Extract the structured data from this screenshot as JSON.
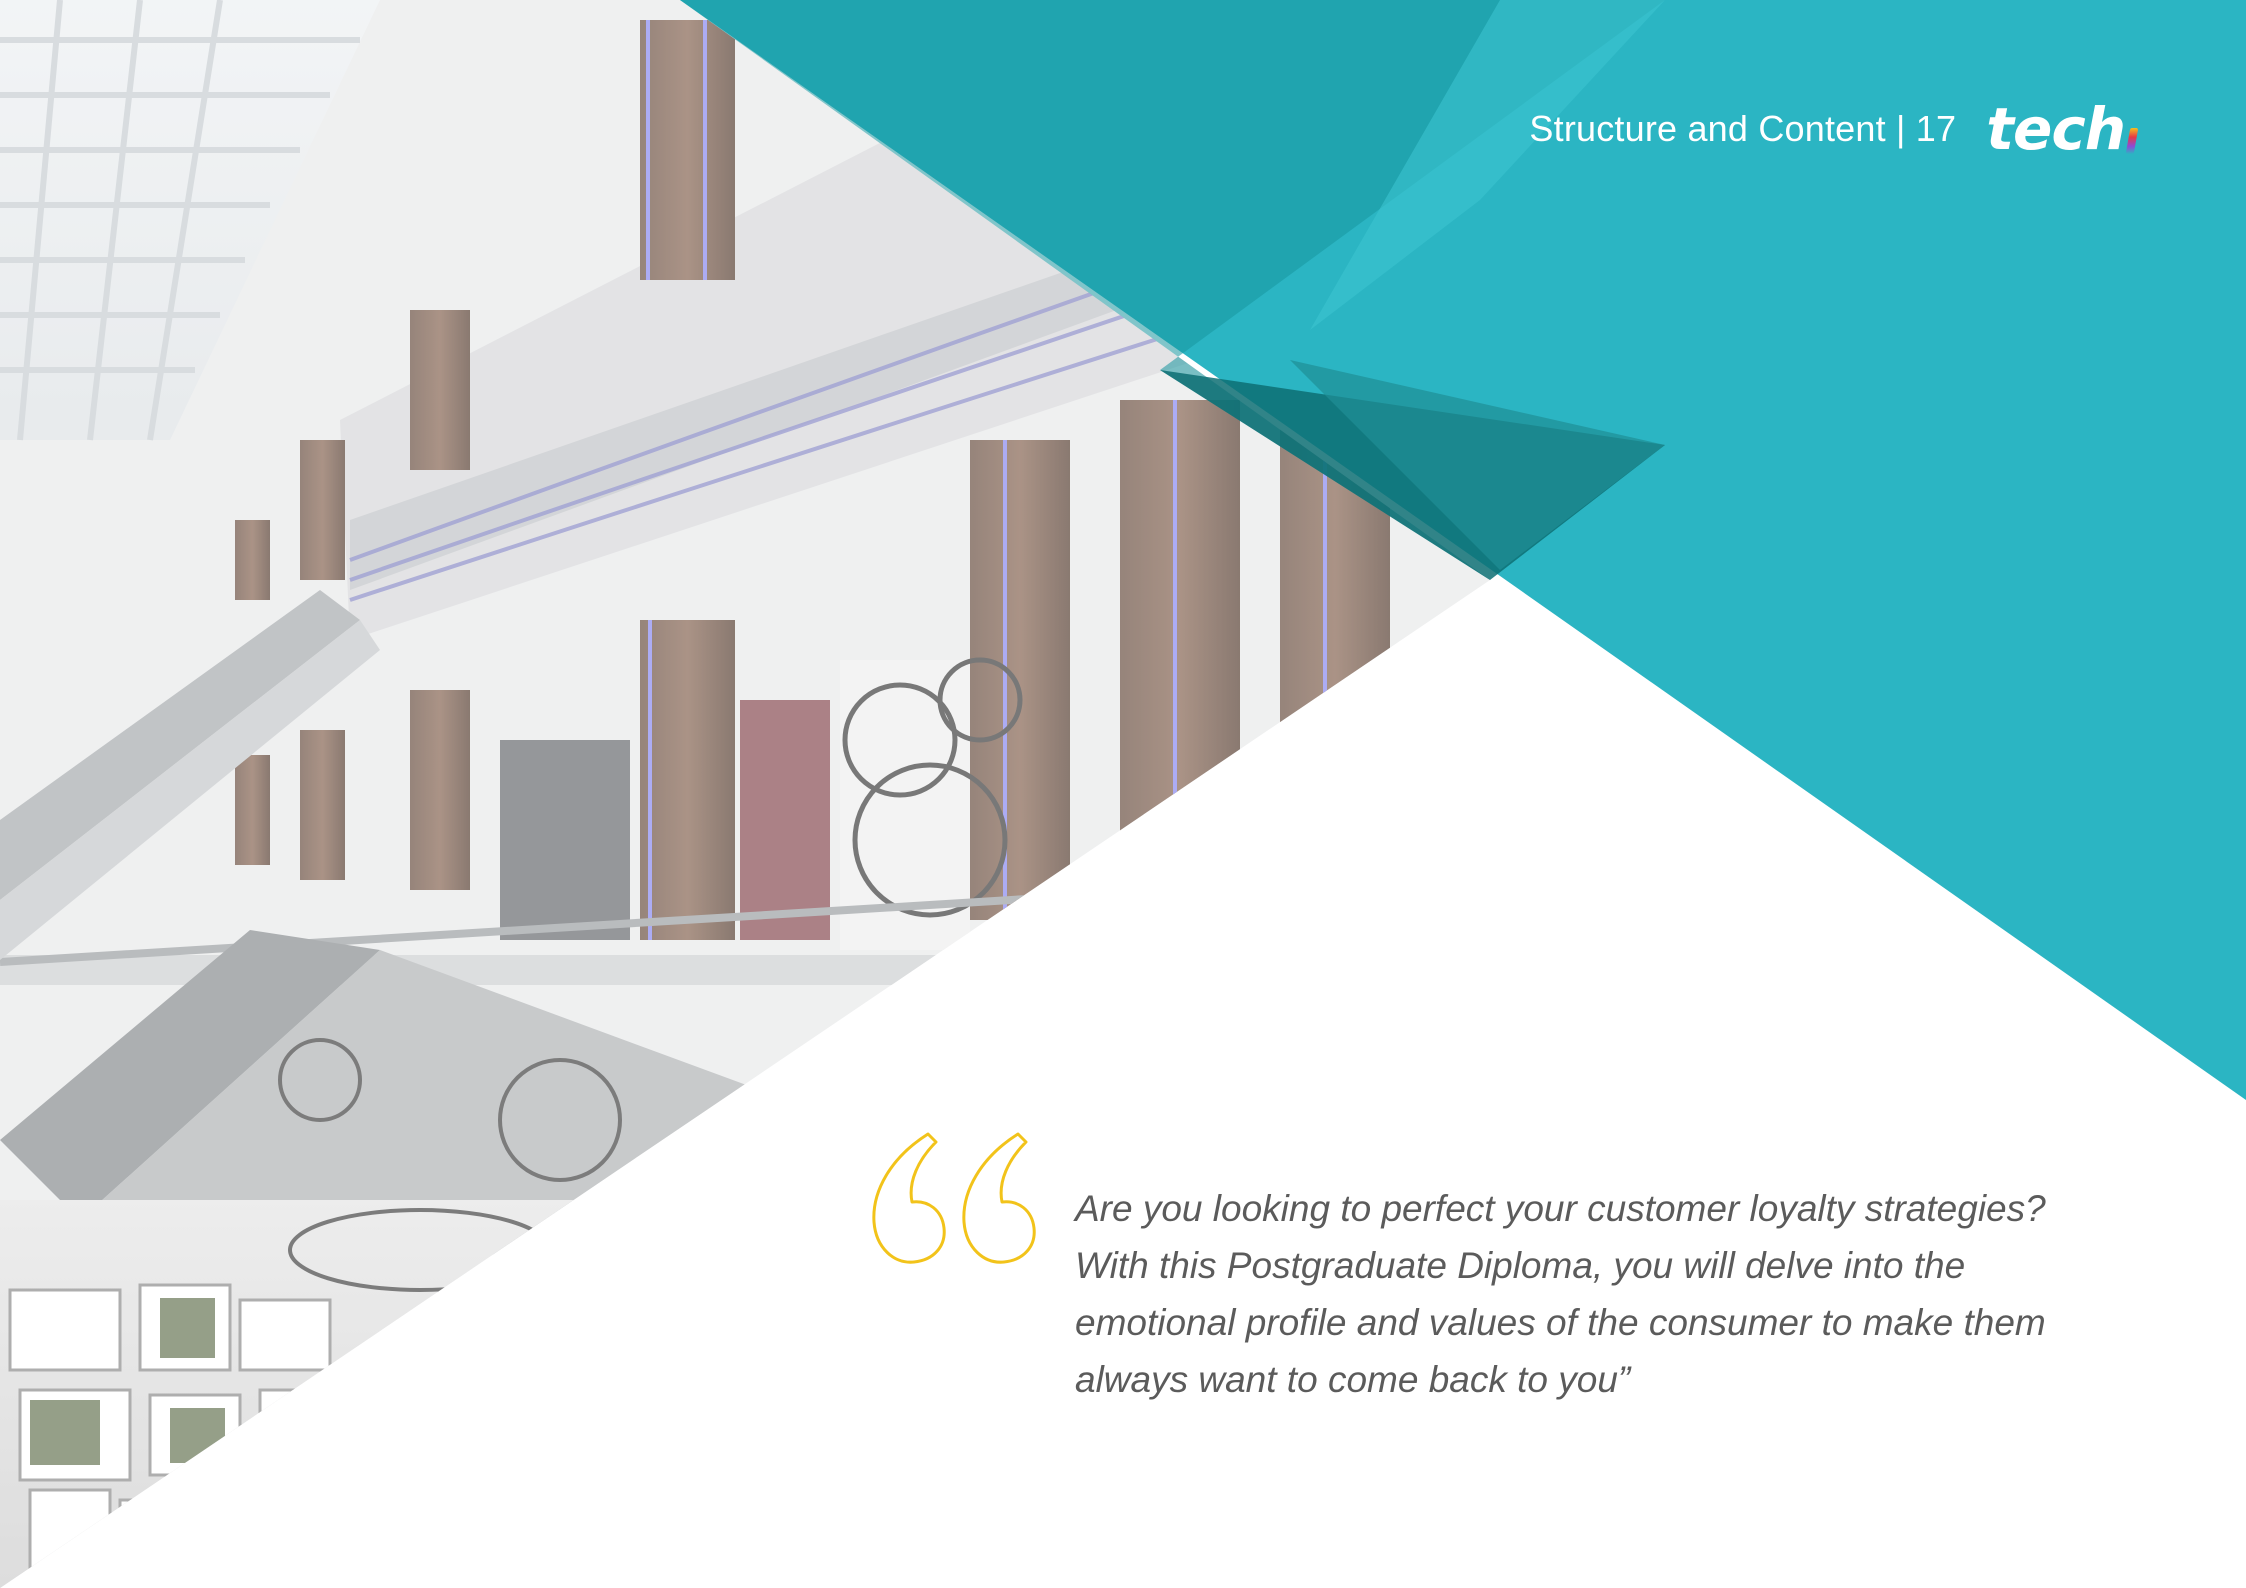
{
  "header": {
    "section": "Structure and Content",
    "separator": "|",
    "page_number": "17",
    "logo_text": "tec",
    "logo_h": "h"
  },
  "quote": {
    "text": "Are you looking to perfect your customer loyalty strategies? With this Postgraduate Diploma, you will delve into the emotional profile and values of the consumer to make them always want to come back to you”"
  },
  "colors": {
    "teal": "#2bb5c3",
    "teal_dark": "#0d6f73",
    "quote_mark": "#f2c31a",
    "body_text": "#5b5b5b"
  },
  "icons": [
    "quote-mark-icon",
    "tech-logo"
  ]
}
